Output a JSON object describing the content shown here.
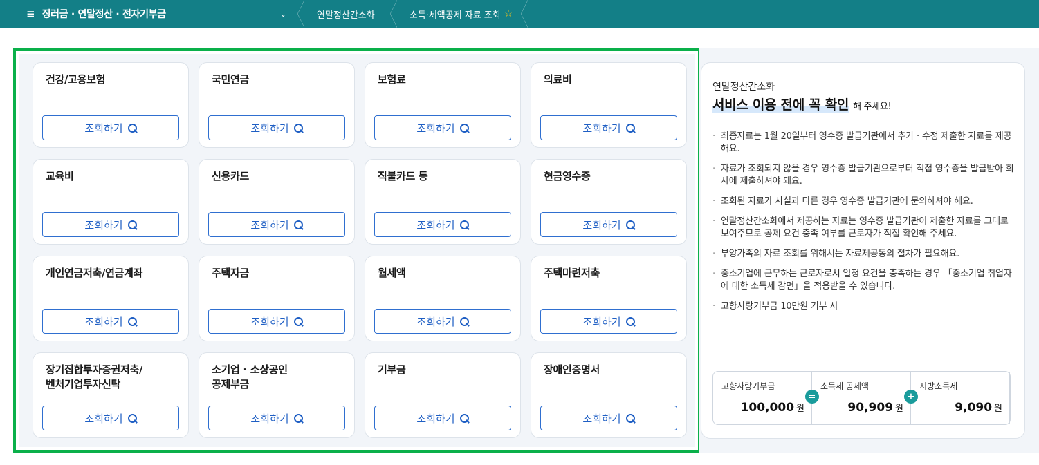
{
  "topbar": {
    "menu_icon": "≡",
    "menu_title": "징러금 · 연말정산 · 전자기부금",
    "chevron": "⌄",
    "crumb1": "연말정산간소화",
    "crumb2": "소득·세액공제 자료 조회",
    "favorite_icon": "star-outline"
  },
  "cards": [
    {
      "title": "건강/고용보험",
      "button": "조회하기"
    },
    {
      "title": "국민연금",
      "button": "조회하기"
    },
    {
      "title": "보험료",
      "button": "조회하기"
    },
    {
      "title": "의료비",
      "button": "조회하기"
    },
    {
      "title": "교육비",
      "button": "조회하기"
    },
    {
      "title": "신용카드",
      "button": "조회하기"
    },
    {
      "title": "직불카드 등",
      "button": "조회하기"
    },
    {
      "title": "현금영수증",
      "button": "조회하기"
    },
    {
      "title": "개인연금저축/연금계좌",
      "button": "조회하기"
    },
    {
      "title": "주택자금",
      "button": "조회하기"
    },
    {
      "title": "월세액",
      "button": "조회하기"
    },
    {
      "title": "주택마련저축",
      "button": "조회하기"
    },
    {
      "title": "장기집합투자증권저축/\n벤처기업투자신탁",
      "button": "조회하기"
    },
    {
      "title": "소기업 · 소상공인\n공제부금",
      "button": "조회하기"
    },
    {
      "title": "기부금",
      "button": "조회하기"
    },
    {
      "title": "장애인증명서",
      "button": "조회하기"
    }
  ],
  "info": {
    "subtitle": "연말정산간소화",
    "headline": "서비스 이용 전에 꼭 확인",
    "headline_tail": "해 주세요!",
    "bullets": [
      "최종자료는 1월 20일부터 영수증 발급기관에서 추가 · 수정 제출한 자료를 제공해요.",
      "자료가 조회되지 않을 경우 영수증 발급기관으로부터 직접 영수증을 발급받아 회사에 제출하셔야 돼요.",
      "조회된 자료가 사실과 다른 경우 영수증 발급기관에 문의하셔야 해요.",
      "연말정산간소화에서 제공하는 자료는 영수증 발급기관이 제출한 자료를 그대로 보여주므로 공제 요건 충족 여부를 근로자가 직접 확인해 주세요.",
      "부양가족의 자료 조회를 위해서는 자료제공동의 절차가 필요해요.",
      "중소기업에 근무하는 근로자로서 일정 요건을 충족하는 경우 「중소기업 취업자에 대한 소득세 감면」을 적용받을 수 있습니다.",
      "고향사랑기부금 10만원 기부 시"
    ],
    "calc": [
      {
        "label": "고향사랑기부금",
        "value": "100,000",
        "unit": "원"
      },
      {
        "label": "소득세 공제액",
        "value": "90,909",
        "unit": "원"
      },
      {
        "label": "지방소득세",
        "value": "9,090",
        "unit": "원"
      }
    ],
    "ops": [
      "=",
      "+"
    ]
  }
}
